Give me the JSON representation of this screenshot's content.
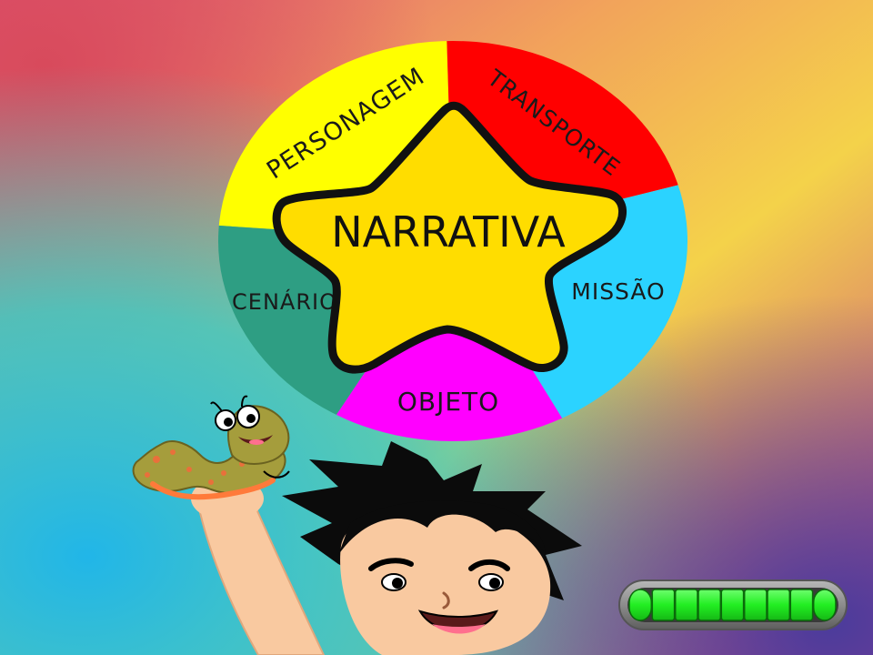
{
  "wheel": {
    "center_label": "NARRATIVA",
    "segments": [
      {
        "id": "personagem",
        "label": "PERSONAGEM",
        "color": "#FFFF00"
      },
      {
        "id": "transporte",
        "label": "TRANSPORTE",
        "color": "#FF0000"
      },
      {
        "id": "missao",
        "label": "MISSÃO",
        "color": "#2BD3FF"
      },
      {
        "id": "objeto",
        "label": "OBJETO",
        "color": "#FF00FF"
      },
      {
        "id": "cenario",
        "label": "CENÁRIO",
        "color": "#2E9E83"
      }
    ],
    "star_color": "#FFDD00"
  },
  "progress": {
    "segments_total": 9,
    "segments_filled": 9,
    "fill_color": "#22EE22",
    "frame_color": "#8C8C8C"
  },
  "characters": {
    "boy": "boy-character",
    "worm": "worm-puppet"
  }
}
